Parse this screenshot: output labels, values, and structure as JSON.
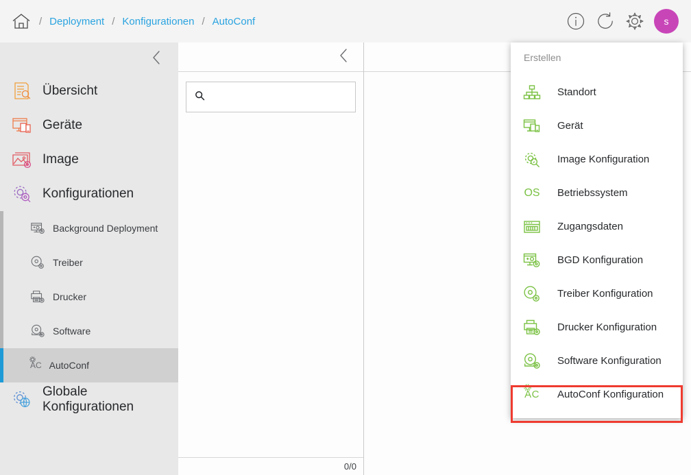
{
  "breadcrumb": {
    "home_icon": "home-icon",
    "items": [
      "Deployment",
      "Konfigurationen",
      "AutoConf"
    ],
    "separator": "/"
  },
  "topbar": {
    "info_icon": "info-icon",
    "refresh_icon": "refresh-icon",
    "settings_icon": "gear-icon",
    "avatar_initial": "s",
    "avatar_color": "#c845b8"
  },
  "sidebar": {
    "collapse_icon": "chevron-left-icon",
    "items": [
      {
        "label": "Übersicht",
        "icon": "overview-document-search-icon"
      },
      {
        "label": "Geräte",
        "icon": "devices-monitor-icon"
      },
      {
        "label": "Image",
        "icon": "image-gear-icon"
      },
      {
        "label": "Konfigurationen",
        "icon": "configurations-gear-icon"
      }
    ],
    "subitems": [
      {
        "label": "Background Deployment",
        "icon": "bgd-icon",
        "selected": false
      },
      {
        "label": "Treiber",
        "icon": "driver-disc-icon",
        "selected": false
      },
      {
        "label": "Drucker",
        "icon": "printer-icon",
        "selected": false
      },
      {
        "label": "Software",
        "icon": "software-disc-icon",
        "selected": false
      },
      {
        "label": "AutoConf",
        "icon": "autoconf-ac-icon",
        "selected": true
      }
    ],
    "global": {
      "label": "Globale Konfigurationen",
      "icon": "globe-gear-icon"
    }
  },
  "list_panel": {
    "collapse_icon": "chevron-left-icon",
    "search": {
      "value": "",
      "placeholder": "",
      "icon": "search-icon"
    },
    "counter": "0/0"
  },
  "dropdown": {
    "title": "Erstellen",
    "accent_color": "#7ac143",
    "highlight_color": "#ef3b30",
    "items": [
      {
        "label": "Standort",
        "icon": "sitemap-icon",
        "highlighted": false
      },
      {
        "label": "Gerät",
        "icon": "device-monitor-icon",
        "highlighted": false
      },
      {
        "label": "Image Konfiguration",
        "icon": "gear-magnifier-icon",
        "highlighted": false
      },
      {
        "label": "Betriebssystem",
        "icon": "os-text-icon",
        "highlighted": false
      },
      {
        "label": "Zugangsdaten",
        "icon": "credentials-keyboard-icon",
        "highlighted": false
      },
      {
        "label": "BGD Konfiguration",
        "icon": "bgd-gear-icon",
        "highlighted": false
      },
      {
        "label": "Treiber Konfiguration",
        "icon": "driver-disc-gear-icon",
        "highlighted": false
      },
      {
        "label": "Drucker Konfiguration",
        "icon": "printer-gear-icon",
        "highlighted": false
      },
      {
        "label": "Software Konfiguration",
        "icon": "software-disc-gear-icon",
        "highlighted": false
      },
      {
        "label": "AutoConf Konfiguration",
        "icon": "autoconf-ac-gear-icon",
        "highlighted": true
      }
    ]
  }
}
